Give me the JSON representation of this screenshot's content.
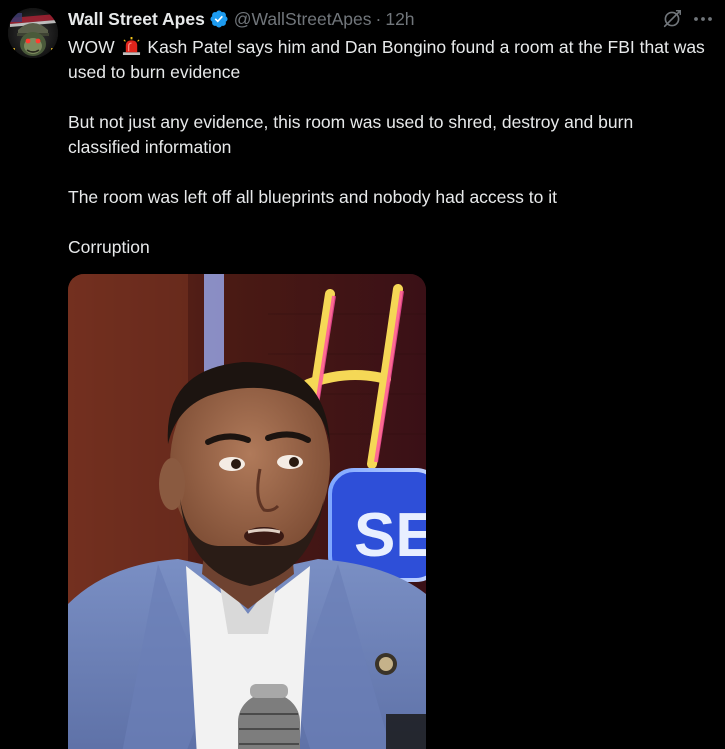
{
  "tweet": {
    "author": {
      "display_name": "Wall Street Apes",
      "handle": "@WallStreetApes",
      "verified": true,
      "avatar_icon": "ape-helmet-avatar-icon"
    },
    "separator": "·",
    "timestamp": "12h",
    "text": {
      "line1_prefix": "WOW",
      "line1_emoji": "siren-emoji-icon",
      "line1_rest": "Kash Patel says him and Dan Bongino found a room at the FBI that was used to burn evidence",
      "paragraph2": "But not just any evidence, this room was used to shred, destroy and burn classified information",
      "paragraph3": "The room was left off all blueprints and nobody had access to it",
      "paragraph4": "Corruption"
    },
    "media": {
      "type": "video-thumbnail",
      "neon_sign_letter": "H",
      "neon_sign_partial": "SE"
    }
  },
  "icons": {
    "verified": "verified-badge-icon",
    "grok": "grok-icon",
    "more": "more-options-icon"
  },
  "colors": {
    "background": "#000000",
    "text_primary": "#e7e9ea",
    "text_secondary": "#71767b",
    "verified_blue": "#1d9bf0"
  }
}
